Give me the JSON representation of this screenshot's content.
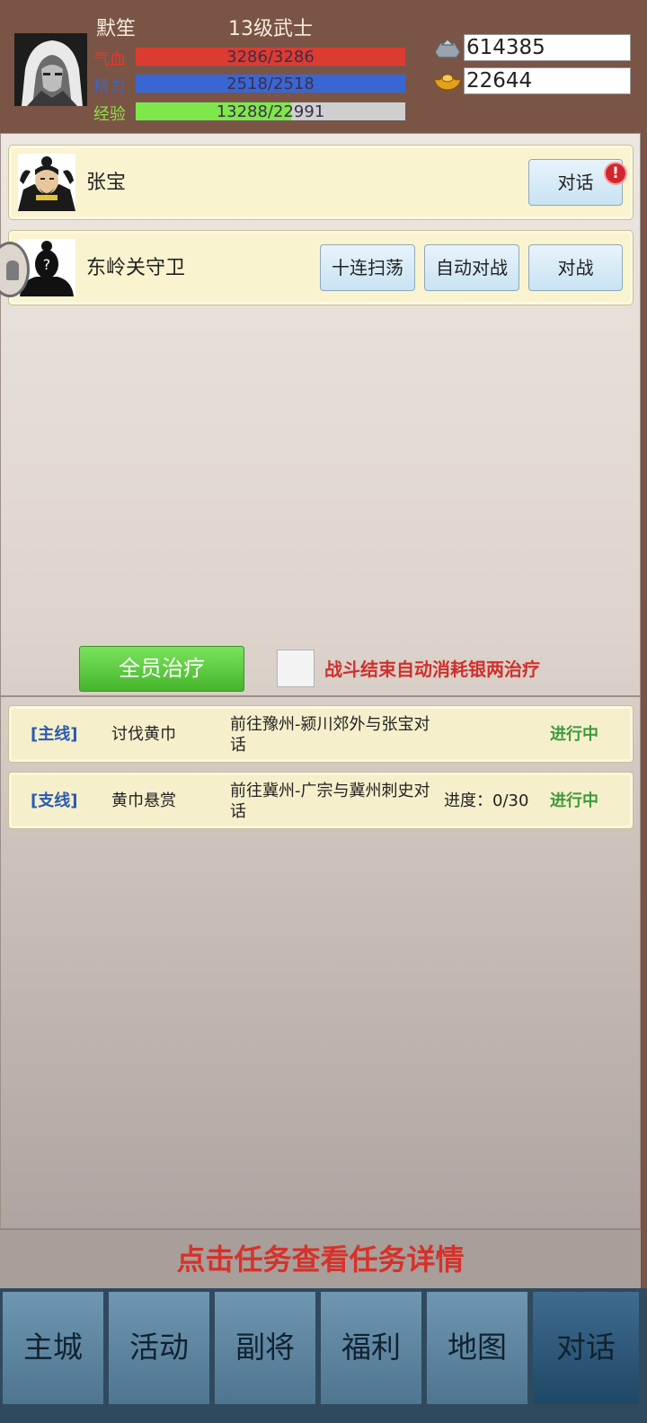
{
  "player": {
    "name": "默笙",
    "rank": "13级武士",
    "stats": [
      {
        "label": "气血",
        "value_text": "3286/3286",
        "fill": 1.0,
        "label_color": "#e03a2e",
        "fill_color": "#dc3b32"
      },
      {
        "label": "精力",
        "value_text": "2518/2518",
        "fill": 1.0,
        "label_color": "#3a66c8",
        "fill_color": "#3a66d4"
      },
      {
        "label": "经验",
        "value_text": "13288/22991",
        "fill": 0.578,
        "label_color": "#8ee04a",
        "fill_color": "#7ee84a"
      }
    ]
  },
  "currency": {
    "silver": {
      "icon": "silver-ingot-icon",
      "value": "614385"
    },
    "gold": {
      "icon": "gold-ingot-icon",
      "value": "22644"
    }
  },
  "npcs": [
    {
      "name": "张宝",
      "portrait": "zhang-bao-portrait",
      "actions": [
        "对话"
      ],
      "has_alert": true,
      "alert": "!"
    },
    {
      "name": "东岭关守卫",
      "portrait": "unknown-guard-portrait",
      "actions": [
        "十连扫荡",
        "自动对战",
        "对战"
      ],
      "has_alert": false
    }
  ],
  "heal": {
    "button": "全员治疗",
    "auto_label": "战斗结束自动消耗银两治疗",
    "auto_checked": false
  },
  "quests": [
    {
      "type": "[主线]",
      "name": "讨伐黄巾",
      "desc": "前往豫州-颍川郊外与张宝对话",
      "progress": "",
      "status": "进行中"
    },
    {
      "type": "[支线]",
      "name": "黄巾悬赏",
      "desc": "前往冀州-广宗与冀州刺史对话",
      "progress": "进度：0/30",
      "status": "进行中"
    }
  ],
  "hint": "点击任务查看任务详情",
  "nav": {
    "items": [
      "主城",
      "活动",
      "副将",
      "福利",
      "地图",
      "对话"
    ],
    "active": "对话"
  }
}
